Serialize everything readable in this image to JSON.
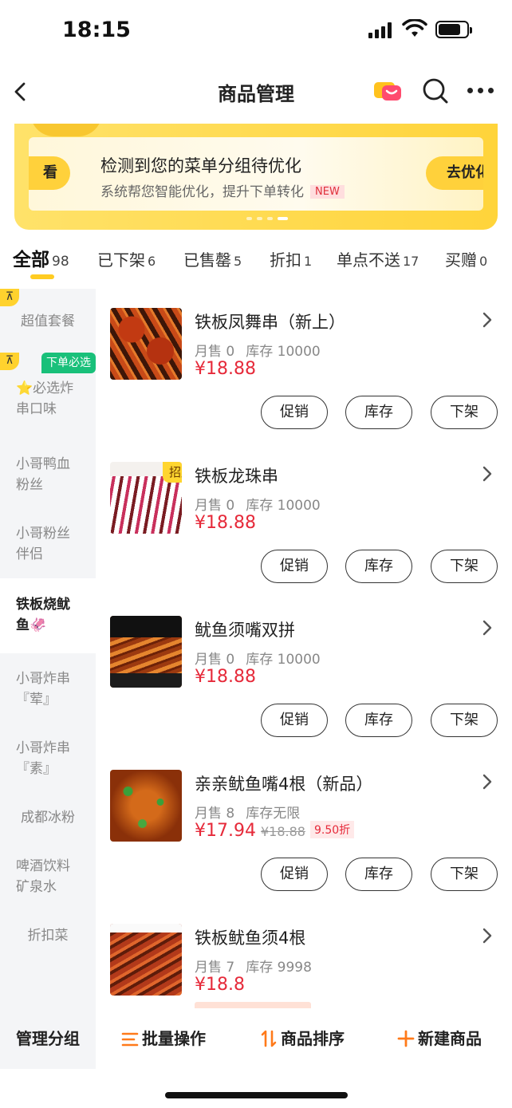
{
  "status_bar": {
    "time": "18:15"
  },
  "nav": {
    "title": "商品管理"
  },
  "banner": {
    "left_pill": "看",
    "title": "检测到您的菜单分组待优化",
    "subtitle": "系统帮您智能优化，提升下单转化",
    "new_badge": "NEW",
    "right_pill": "去优化"
  },
  "tabs": [
    {
      "label": "全部",
      "count": "98"
    },
    {
      "label": "已下架",
      "count": "6"
    },
    {
      "label": "已售罄",
      "count": "5"
    },
    {
      "label": "折扣",
      "count": "1"
    },
    {
      "label": "单点不送",
      "count": "17"
    },
    {
      "label": "买赠",
      "count": "0"
    }
  ],
  "sidebar": {
    "pin_icon": "⊼",
    "tag": "下单必选",
    "items": [
      {
        "label": "超值套餐"
      },
      {
        "line1": "⭐必选炸",
        "line2": "串口味"
      },
      {
        "line1": "小哥鸭血",
        "line2": "粉丝"
      },
      {
        "line1": "小哥粉丝",
        "line2": "伴侣"
      },
      {
        "line1": "铁板烧鱿",
        "line2": "鱼🦑"
      },
      {
        "line1": "小哥炸串",
        "line2": "『荤』"
      },
      {
        "line1": "小哥炸串",
        "line2": "『素』"
      },
      {
        "label": "成都冰粉"
      },
      {
        "line1": "啤酒饮料",
        "line2": "矿泉水"
      },
      {
        "label": "折扣菜"
      }
    ]
  },
  "buttons": {
    "promo": "促销",
    "stock": "库存",
    "offshelf": "下架"
  },
  "products": [
    {
      "name": "铁板凤舞串（新上）",
      "sales": "月售 0",
      "stock": "库存 10000",
      "price": "¥18.88"
    },
    {
      "name": "铁板龙珠串",
      "badge": "招牌",
      "sales": "月售 0",
      "stock": "库存 10000",
      "price": "¥18.88"
    },
    {
      "name": "鱿鱼须嘴双拼",
      "sales": "月售 0",
      "stock": "库存 10000",
      "price": "¥18.88"
    },
    {
      "name": "亲亲鱿鱼嘴4根（新品）",
      "sales": "月售 8",
      "stock": "库存无限",
      "price": "¥17.94",
      "orig_price": "¥18.88",
      "discount": "9.50折"
    },
    {
      "name": "铁板鱿鱼须4根",
      "sales": "月售 7",
      "stock": "库存 9998",
      "price": "¥18.8"
    }
  ],
  "bottom_bar": {
    "manage_group": "管理分组",
    "batch": "批量操作",
    "sort": "商品排序",
    "new_product": "新建商品"
  },
  "colors": {
    "accent": "#ffcc22",
    "price": "#e62a3a",
    "tag_green": "#19c07a"
  }
}
